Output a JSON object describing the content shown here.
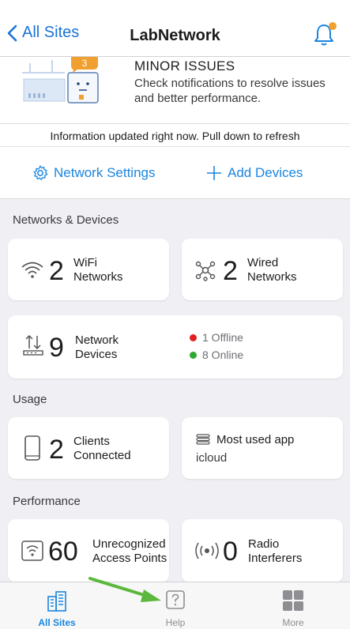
{
  "header": {
    "back_label": "All Sites",
    "title": "LabNetwork"
  },
  "status": {
    "badge_count": "3",
    "title": "MINOR ISSUES",
    "description": "Check notifications to resolve issues and better performance.",
    "info": "Information updated right now. Pull down to refresh"
  },
  "actions": {
    "network_settings": "Network Settings",
    "add_devices": "Add Devices"
  },
  "networks_devices": {
    "section_title": "Networks & Devices",
    "wifi": {
      "count": "2",
      "label_line1": "WiFi",
      "label_line2": "Networks"
    },
    "wired": {
      "count": "2",
      "label_line1": "Wired",
      "label_line2": "Networks"
    },
    "devices": {
      "count": "9",
      "label_line1": "Network",
      "label_line2": "Devices",
      "offline": "1 Offline",
      "online": "8 Online"
    }
  },
  "usage": {
    "section_title": "Usage",
    "clients": {
      "count": "2",
      "label_line1": "Clients",
      "label_line2": "Connected"
    },
    "most_used": {
      "title": "Most used app",
      "value": "icloud"
    }
  },
  "performance": {
    "section_title": "Performance",
    "unrecognized": {
      "count": "60",
      "label_line1": "Unrecognized",
      "label_line2": "Access Points"
    },
    "radio": {
      "count": "0",
      "label_line1": "Radio",
      "label_line2": "Interferers"
    }
  },
  "tabbar": {
    "all_sites": "All Sites",
    "help": "Help",
    "more": "More"
  },
  "colors": {
    "accent": "#1a86e0",
    "offline": "#e02020",
    "online": "#2ea82e",
    "badge": "#f0a030",
    "arrow": "#5cb83c"
  }
}
